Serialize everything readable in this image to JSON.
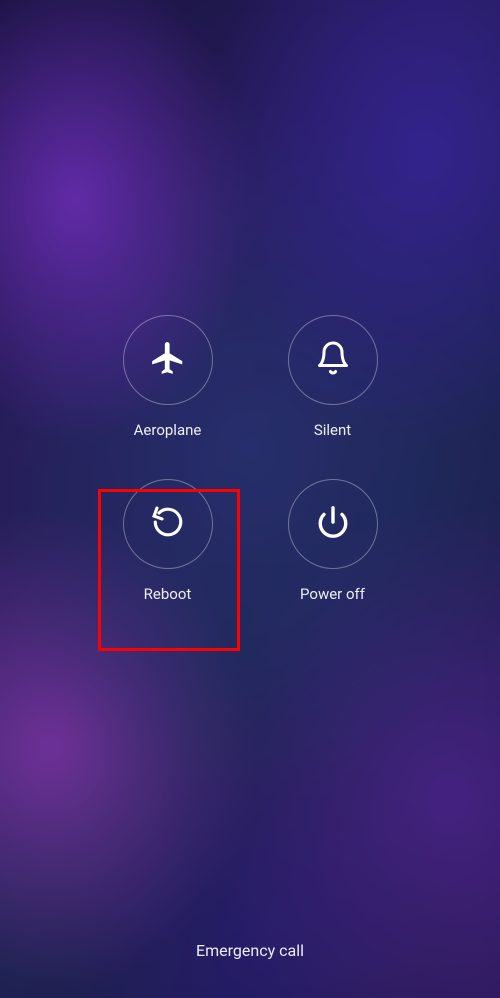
{
  "options": {
    "aeroplane": {
      "label": "Aeroplane"
    },
    "silent": {
      "label": "Silent"
    },
    "reboot": {
      "label": "Reboot"
    },
    "poweroff": {
      "label": "Power off"
    }
  },
  "emergency_label": "Emergency call",
  "highlight_target": "reboot"
}
